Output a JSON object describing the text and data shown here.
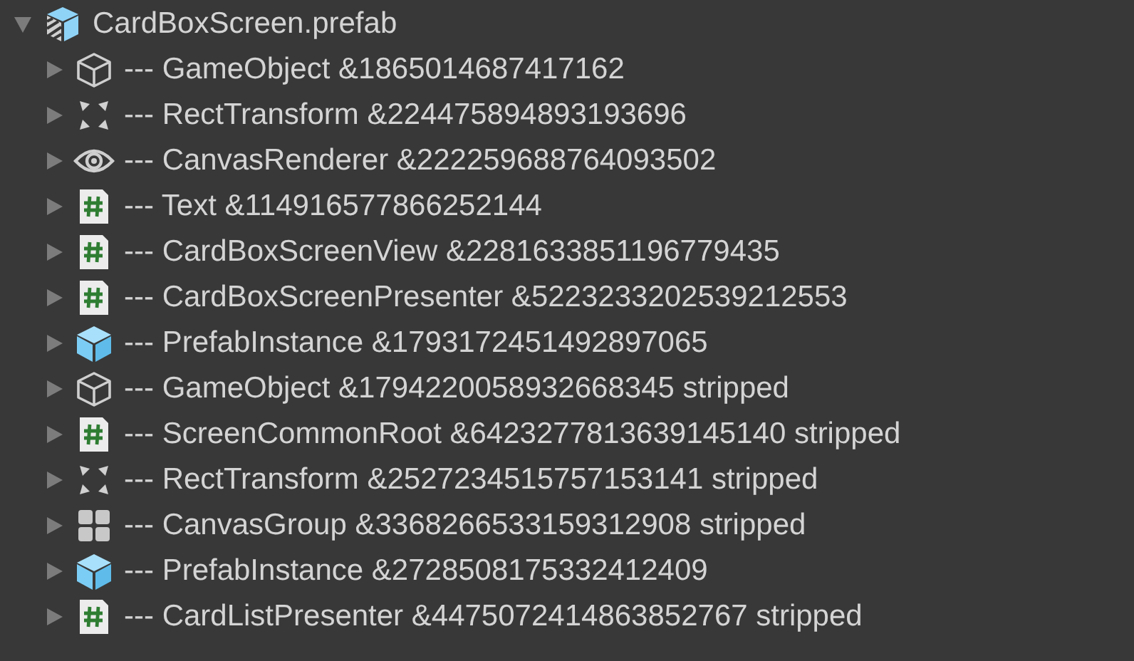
{
  "tree": {
    "label": "CardBoxScreen.prefab",
    "expanded": true,
    "kind": "prefab_asset",
    "children": [
      {
        "label": "--- GameObject &1865014687417162",
        "kind": "gameobject",
        "expanded": false
      },
      {
        "label": "--- RectTransform &224475894893193696",
        "kind": "recttransform",
        "expanded": false
      },
      {
        "label": "--- CanvasRenderer &222259688764093502",
        "kind": "canvasrenderer",
        "expanded": false
      },
      {
        "label": "--- Text &114916577866252144",
        "kind": "script",
        "expanded": false
      },
      {
        "label": "--- CardBoxScreenView &2281633851196779435",
        "kind": "script",
        "expanded": false
      },
      {
        "label": "--- CardBoxScreenPresenter &5223233202539212553",
        "kind": "script",
        "expanded": false
      },
      {
        "label": "--- PrefabInstance &1793172451492897065",
        "kind": "prefab",
        "expanded": false
      },
      {
        "label": "--- GameObject &1794220058932668345 stripped",
        "kind": "gameobject",
        "expanded": false
      },
      {
        "label": "--- ScreenCommonRoot &6423277813639145140 stripped",
        "kind": "script",
        "expanded": false
      },
      {
        "label": "--- RectTransform &2527234515757153141 stripped",
        "kind": "recttransform",
        "expanded": false
      },
      {
        "label": "--- CanvasGroup &3368266533159312908 stripped",
        "kind": "canvasgroup",
        "expanded": false
      },
      {
        "label": "--- PrefabInstance &2728508175332412409",
        "kind": "prefab",
        "expanded": false
      },
      {
        "label": "--- CardListPresenter &4475072414863852767 stripped",
        "kind": "script",
        "expanded": false
      }
    ]
  }
}
